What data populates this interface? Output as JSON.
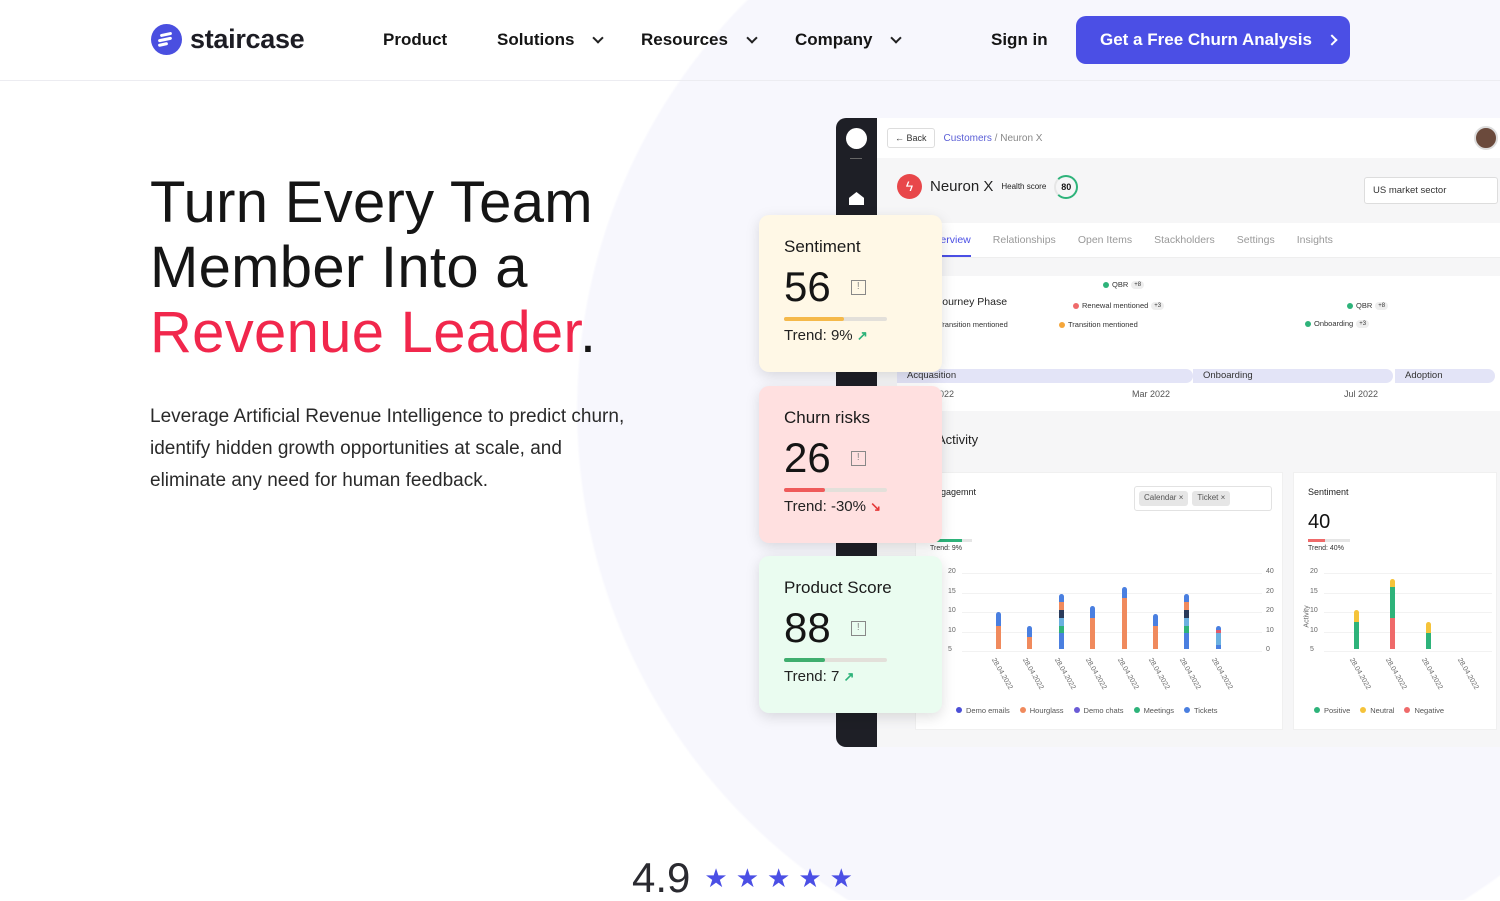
{
  "brand": {
    "name": "staircase",
    "accent": "#4b4fe5",
    "highlight": "#f1274c"
  },
  "nav": {
    "items": [
      {
        "label": "Product",
        "dropdown": false
      },
      {
        "label": "Solutions",
        "dropdown": true
      },
      {
        "label": "Resources",
        "dropdown": true
      },
      {
        "label": "Company",
        "dropdown": true
      }
    ],
    "sign_in": "Sign in",
    "cta": "Get a Free Churn Analysis"
  },
  "hero": {
    "line1": "Turn Every Team",
    "line2": "Member Into a",
    "highlight": "Revenue Leader",
    "period": ".",
    "description": "Leverage Artificial Revenue Intelligence to predict churn, identify hidden growth opportunities at scale, and eliminate any need for human feedback."
  },
  "mockup": {
    "back": "← Back",
    "crumb_link": "Customers",
    "crumb_sep": " / ",
    "crumb_current": "Neuron X",
    "account": "Neuron X",
    "health_label": "Health score",
    "health_score": "80",
    "sector": "US market sector",
    "tabs": [
      "Overview",
      "Relationships",
      "Open Items",
      "Stackholders",
      "Settings",
      "Insights"
    ],
    "journey": {
      "title": "Journey Phase",
      "events": [
        {
          "label": "QBR",
          "more": "+8",
          "color": "#2eb37a"
        },
        {
          "label": "Renewal mentioned",
          "more": "+3",
          "color": "#ef6a6a"
        },
        {
          "label": "Transition mentioned",
          "more": "",
          "color": "#f5a63a"
        },
        {
          "label": "Transition mentioned",
          "more": "",
          "color": "#f5a63a"
        },
        {
          "label": "QBR",
          "more": "+8",
          "color": "#2eb37a"
        },
        {
          "label": "Onboarding",
          "more": "+3",
          "color": "#2eb37a"
        }
      ],
      "phases": [
        "Acquasition",
        "Onboarding",
        "Adoption"
      ],
      "months": [
        "Jan 2022",
        "Mar 2022",
        "Jul 2022"
      ]
    },
    "activity_title": "Activity",
    "engagement": {
      "title": "Engagemnt",
      "value": "5",
      "trend": "Trend: 9%",
      "progress": 0.75,
      "chips": [
        "Calendar ×",
        "Ticket ×"
      ],
      "y_ticks": [
        "20",
        "15",
        "10",
        "10",
        "5"
      ],
      "y2_ticks": [
        "40",
        "20",
        "20",
        "10",
        "0"
      ],
      "x_labels": [
        "28.04.2022",
        "28.04.2022",
        "28.04.2022",
        "28.04.2022",
        "28.04.2022",
        "28.04.2022",
        "28.04.2022",
        "28.04.2022"
      ],
      "legend": [
        {
          "label": "Demo emails",
          "color": "#4b4fd6"
        },
        {
          "label": "Hourglass",
          "color": "#f08a5d"
        },
        {
          "label": "Demo chats",
          "color": "#6a5bd6"
        },
        {
          "label": "Meetings",
          "color": "#2eb37a"
        },
        {
          "label": "Tickets",
          "color": "#4a7fe0"
        }
      ],
      "bars": [
        [
          [
            "#f08a5d",
            6
          ],
          [
            "#4a7fe0",
            3.5
          ]
        ],
        [
          [
            "#f08a5d",
            3
          ],
          [
            "#4a7fe0",
            3
          ]
        ],
        [
          [
            "#4a7fe0",
            4
          ],
          [
            "#2eb37a",
            2
          ],
          [
            "#6ab0e0",
            2
          ],
          [
            "#2a3a5a",
            2
          ],
          [
            "#f08a5d",
            2
          ],
          [
            "#4a7fe0",
            2
          ]
        ],
        [
          [
            "#f08a5d",
            8
          ],
          [
            "#4a7fe0",
            3
          ]
        ],
        [
          [
            "#f08a5d",
            13
          ],
          [
            "#4a7fe0",
            3
          ]
        ],
        [
          [
            "#f08a5d",
            6
          ],
          [
            "#4a7fe0",
            3
          ]
        ],
        [
          [
            "#4a7fe0",
            4
          ],
          [
            "#2eb37a",
            2
          ],
          [
            "#6ab0e0",
            2
          ],
          [
            "#2a3a5a",
            2
          ],
          [
            "#f08a5d",
            2
          ],
          [
            "#4a7fe0",
            2
          ]
        ],
        [
          [
            "#4a7fe0",
            1
          ],
          [
            "#6ab0e0",
            3
          ],
          [
            "#e05a6a",
            1
          ],
          [
            "#4a7fe0",
            1
          ]
        ]
      ]
    },
    "sentiment": {
      "title": "Sentiment",
      "value": "40",
      "trend": "Trend: 40%",
      "progress": 0.4,
      "y_label": "Activity",
      "y_ticks": [
        "20",
        "15",
        "10",
        "10",
        "5"
      ],
      "x_labels": [
        "28.04.2022",
        "28.04.2022",
        "28.04.2022",
        "28.04.2022"
      ],
      "legend": [
        {
          "label": "Positive",
          "color": "#2eb37a"
        },
        {
          "label": "Neutral",
          "color": "#f5c33a"
        },
        {
          "label": "Negative",
          "color": "#ef6a6a"
        }
      ],
      "bars": [
        [
          [
            "#2eb37a",
            7
          ],
          [
            "#f5c33a",
            3
          ]
        ],
        [
          [
            "#ef6a6a",
            8
          ],
          [
            "#2eb37a",
            8
          ],
          [
            "#f5c33a",
            2
          ]
        ],
        [
          [
            "#2eb37a",
            4
          ],
          [
            "#f5c33a",
            3
          ]
        ],
        []
      ]
    }
  },
  "cards": [
    {
      "title": "Sentiment",
      "value": "56",
      "trend_label": "Trend:",
      "trend": "9%",
      "direction": "up",
      "progress": 0.58,
      "bg": "#fff8e6",
      "bar": "#f5b94a"
    },
    {
      "title": "Churn risks",
      "value": "26",
      "trend_label": "Trend:",
      "trend": "-30%",
      "direction": "down",
      "progress": 0.4,
      "bg": "#ffe0e0",
      "bar": "#ef5a5a"
    },
    {
      "title": "Product Score",
      "value": "88",
      "trend_label": "Trend:",
      "trend": "7",
      "direction": "up",
      "progress": 0.4,
      "bg": "#eafcf0",
      "bar": "#3fae6e"
    }
  ],
  "rating": {
    "score": "4.9",
    "stars": 5
  }
}
